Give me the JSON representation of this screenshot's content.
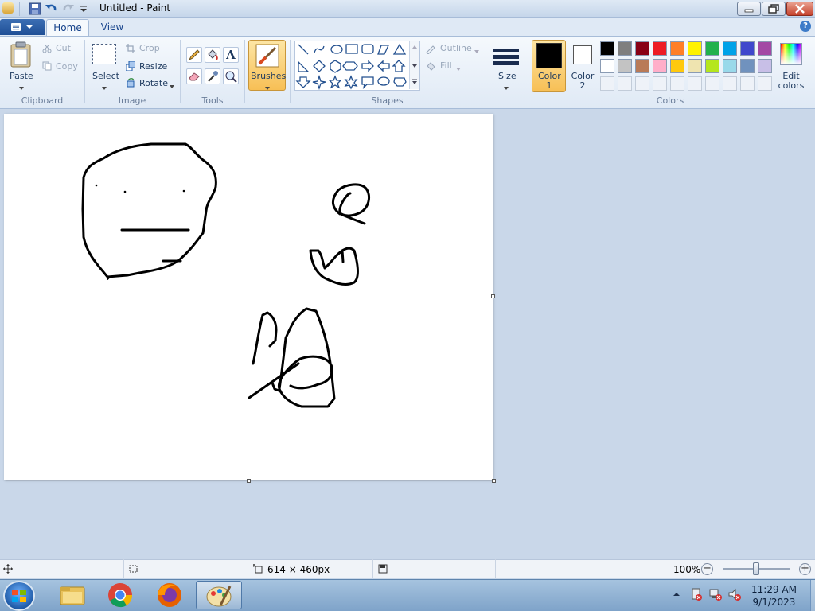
{
  "window": {
    "title": "Untitled - Paint"
  },
  "tabs": {
    "home": "Home",
    "view": "View"
  },
  "help_icon": "?",
  "clipboard": {
    "paste": "Paste",
    "cut": "Cut",
    "copy": "Copy",
    "group": "Clipboard"
  },
  "image": {
    "select": "Select",
    "crop": "Crop",
    "resize": "Resize",
    "rotate": "Rotate",
    "group": "Image"
  },
  "tools": {
    "group": "Tools",
    "text_tool": "A"
  },
  "brushes": {
    "label": "Brushes"
  },
  "shapes": {
    "outline": "Outline",
    "fill": "Fill",
    "group": "Shapes"
  },
  "size": {
    "label": "Size"
  },
  "colors": {
    "color1_line1": "Color",
    "color1_line2": "1",
    "color2_line1": "Color",
    "color2_line2": "2",
    "edit_line1": "Edit",
    "edit_line2": "colors",
    "group": "Colors",
    "color1": "#000000",
    "color2": "#ffffff",
    "palette": [
      "#000000",
      "#7f7f7f",
      "#880015",
      "#ed1c24",
      "#ff7f27",
      "#fff200",
      "#22b14c",
      "#00a2e8",
      "#3f48cc",
      "#a349a4",
      "#ffffff",
      "#c3c3c3",
      "#b97a57",
      "#ffaec9",
      "#ffc90e",
      "#efe4b0",
      "#b5e61d",
      "#99d9ea",
      "#7092be",
      "#c8bfe7"
    ]
  },
  "status": {
    "canvas_size": "614 × 460px",
    "zoom": "100%"
  },
  "taskbar": {
    "time": "11:29 AM",
    "date": "9/1/2023"
  }
}
